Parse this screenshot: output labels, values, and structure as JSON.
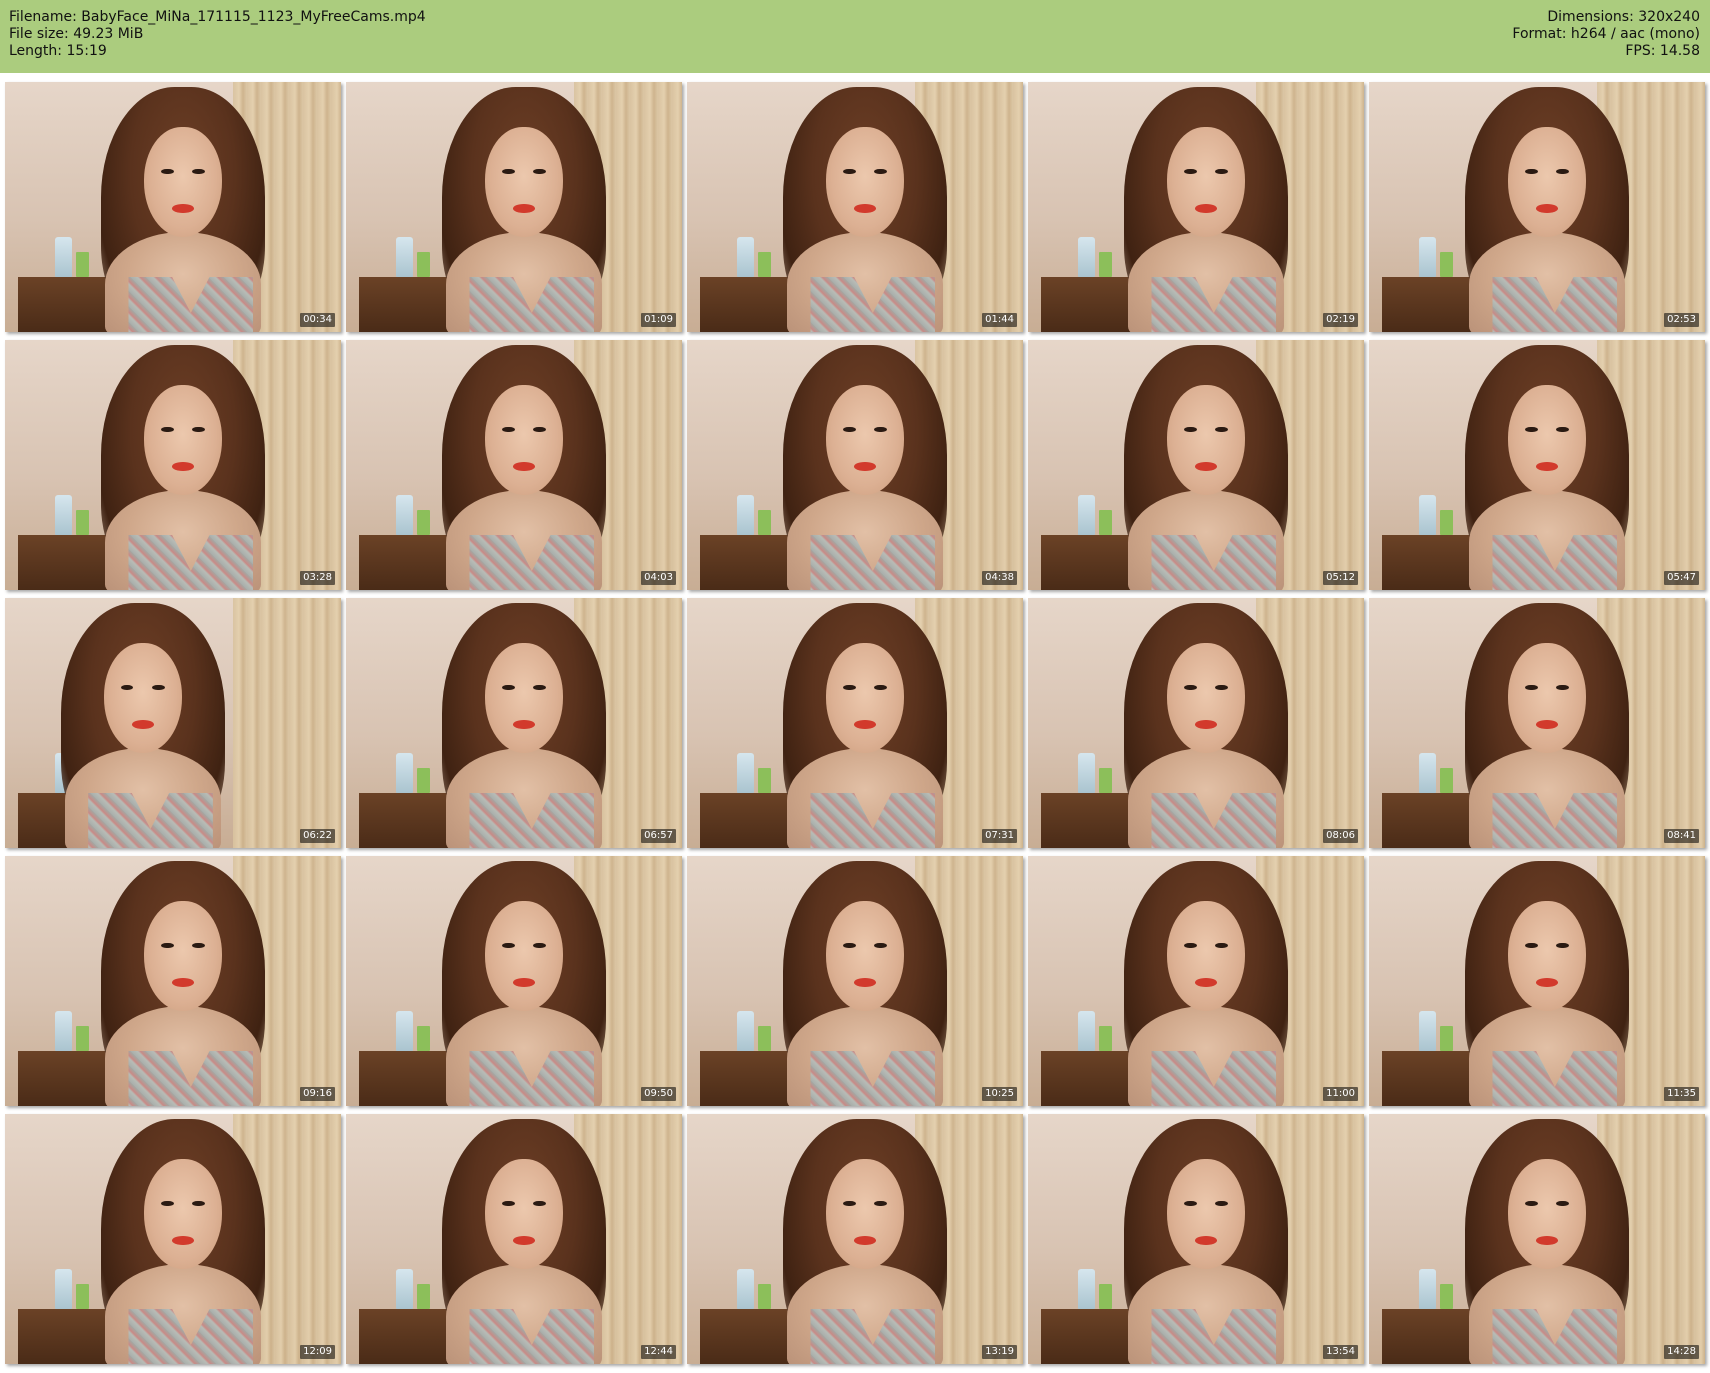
{
  "header": {
    "filename": "Filename: BabyFace_MiNa_171115_1123_MyFreeCams.mp4",
    "filesize": "File size: 49.23 MiB",
    "length": "Length: 15:19",
    "dimensions": "Dimensions: 320x240",
    "format": "Format: h264 / aac (mono)",
    "fps": "FPS: 14.58"
  },
  "colors": {
    "header_bg": "#abcc7e",
    "page_bg": "#ffffff"
  },
  "thumbnails": [
    {
      "timestamp": "00:34",
      "pose": "center"
    },
    {
      "timestamp": "01:09",
      "pose": "center"
    },
    {
      "timestamp": "01:44",
      "pose": "center"
    },
    {
      "timestamp": "02:19",
      "pose": "center"
    },
    {
      "timestamp": "02:53",
      "pose": "center"
    },
    {
      "timestamp": "03:28",
      "pose": "center"
    },
    {
      "timestamp": "04:03",
      "pose": "center"
    },
    {
      "timestamp": "04:38",
      "pose": "center"
    },
    {
      "timestamp": "05:12",
      "pose": "center"
    },
    {
      "timestamp": "05:47",
      "pose": "center"
    },
    {
      "timestamp": "06:22",
      "pose": "left"
    },
    {
      "timestamp": "06:57",
      "pose": "center"
    },
    {
      "timestamp": "07:31",
      "pose": "center"
    },
    {
      "timestamp": "08:06",
      "pose": "center"
    },
    {
      "timestamp": "08:41",
      "pose": "center"
    },
    {
      "timestamp": "09:16",
      "pose": "center"
    },
    {
      "timestamp": "09:50",
      "pose": "center"
    },
    {
      "timestamp": "10:25",
      "pose": "center"
    },
    {
      "timestamp": "11:00",
      "pose": "center"
    },
    {
      "timestamp": "11:35",
      "pose": "center"
    },
    {
      "timestamp": "12:09",
      "pose": "center"
    },
    {
      "timestamp": "12:44",
      "pose": "center"
    },
    {
      "timestamp": "13:19",
      "pose": "center"
    },
    {
      "timestamp": "13:54",
      "pose": "center"
    },
    {
      "timestamp": "14:28",
      "pose": "center"
    }
  ]
}
